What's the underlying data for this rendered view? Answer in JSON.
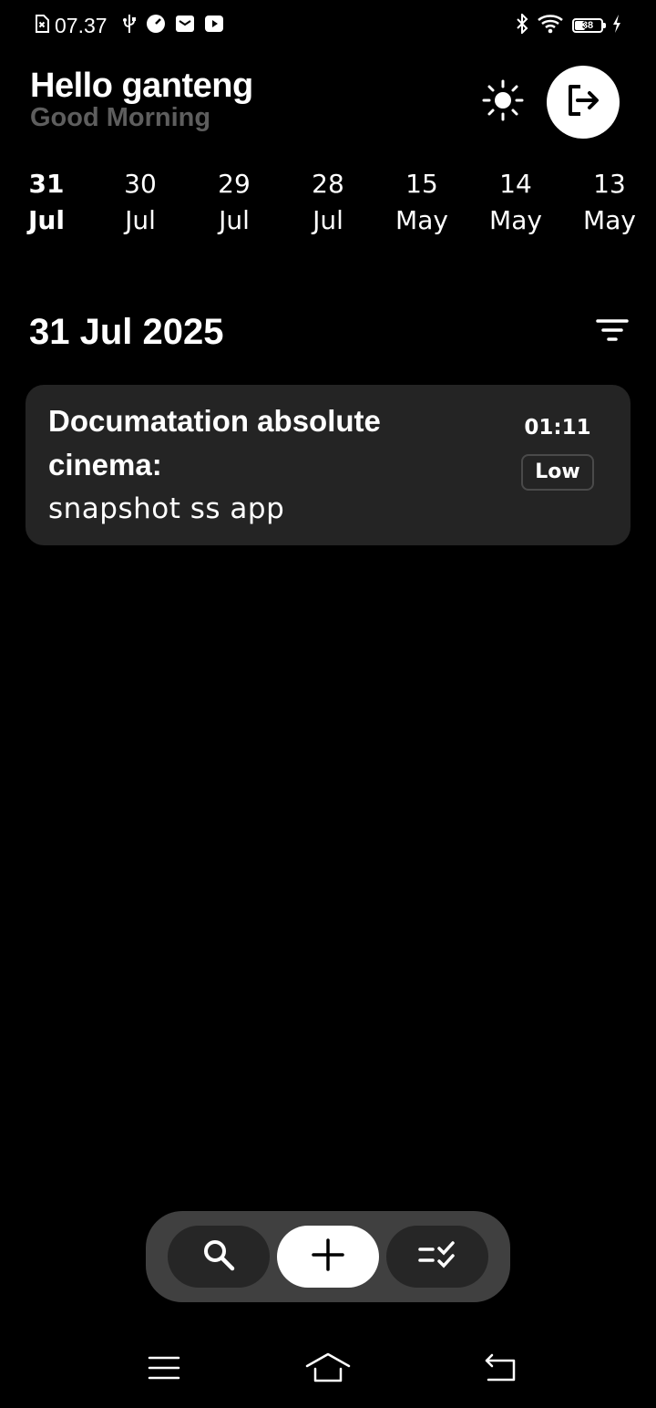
{
  "status_bar": {
    "time": "07.37",
    "battery_level": "38",
    "icons": [
      "sim-missing-icon",
      "usb-icon",
      "speed-icon",
      "mail-icon",
      "youtube-icon",
      "bluetooth-icon",
      "wifi-icon",
      "battery-icon",
      "charging-icon"
    ]
  },
  "header": {
    "title": "Hello ganteng",
    "subtitle": "Good Morning",
    "theme_icon": "sun-icon",
    "logout_icon": "logout-icon"
  },
  "date_strip": [
    {
      "day": "31",
      "month": "Jul",
      "selected": true
    },
    {
      "day": "30",
      "month": "Jul",
      "selected": false
    },
    {
      "day": "29",
      "month": "Jul",
      "selected": false
    },
    {
      "day": "28",
      "month": "Jul",
      "selected": false
    },
    {
      "day": "15",
      "month": "May",
      "selected": false
    },
    {
      "day": "14",
      "month": "May",
      "selected": false
    },
    {
      "day": "13",
      "month": "May",
      "selected": false
    }
  ],
  "section": {
    "date": "31 Jul 2025",
    "filter_icon": "filter-icon"
  },
  "tasks": [
    {
      "title": "Documatation absolute cinema:",
      "description": "snapshot ss app",
      "time": "01:11",
      "priority": "Low"
    }
  ],
  "action_bar": {
    "search_icon": "search-icon",
    "add_icon": "plus-icon",
    "tasks_icon": "checklist-icon"
  },
  "colors": {
    "background": "#000000",
    "card": "#242424",
    "muted_text": "#5e5e5e",
    "action_bar": "#404040",
    "accent": "#ffffff"
  }
}
